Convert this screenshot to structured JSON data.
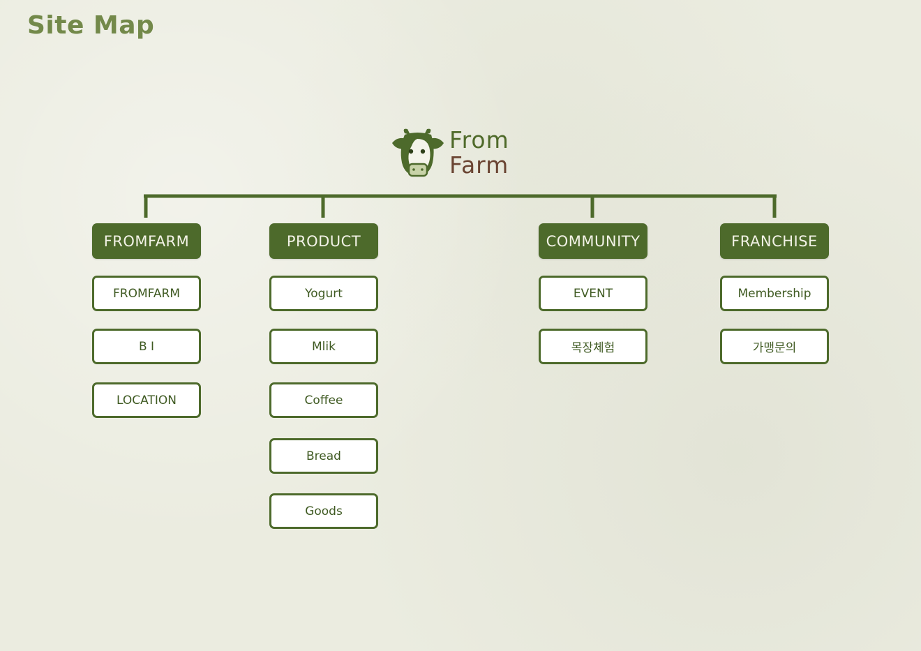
{
  "page": {
    "title": "Site Map"
  },
  "logo": {
    "line1": "From",
    "line2": "Farm",
    "icon": "cow-icon"
  },
  "colors": {
    "primary": "#4d6a2b",
    "title": "#73894a",
    "background": "#ebece0",
    "logo_brown": "#6a4432"
  },
  "sitemap": {
    "columns": [
      {
        "label": "FROMFARM",
        "items": [
          "FROMFARM",
          "B I",
          "LOCATION"
        ]
      },
      {
        "label": "PRODUCT",
        "items": [
          "Yogurt",
          "Mlik",
          "Coffee",
          "Bread",
          "Goods"
        ]
      },
      {
        "label": "COMMUNITY",
        "items": [
          "EVENT",
          "목장체험"
        ]
      },
      {
        "label": "FRANCHISE",
        "items": [
          "Membership",
          "가맹문의"
        ]
      }
    ]
  }
}
